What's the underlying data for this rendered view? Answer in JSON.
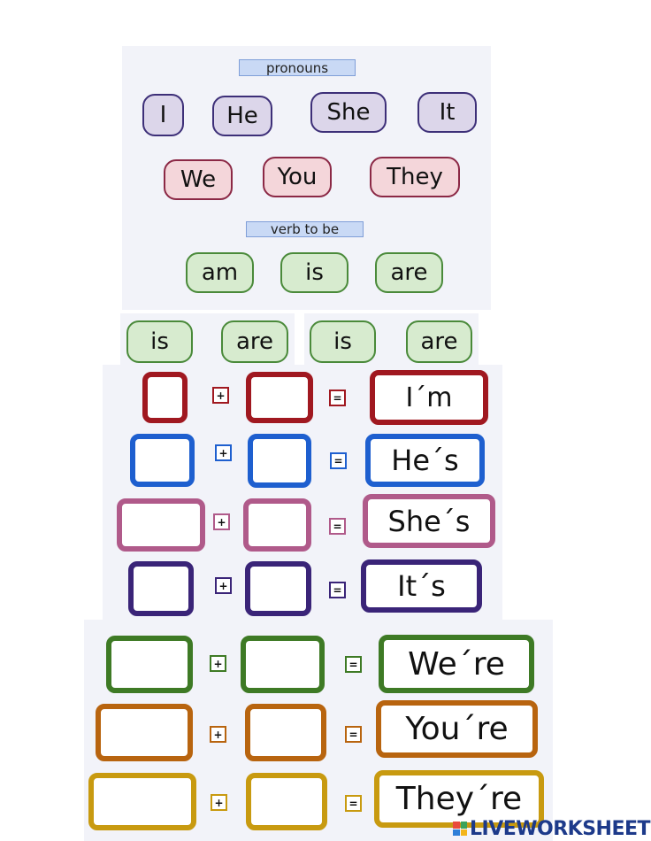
{
  "headings": {
    "pronouns": "pronouns",
    "verb_to_be": "verb to be"
  },
  "pronouns": [
    "I",
    "He",
    "She",
    "It",
    "We",
    "You",
    "They"
  ],
  "verbs": [
    "am",
    "is",
    "are"
  ],
  "verb_strip": [
    "is",
    "are",
    "is",
    "are"
  ],
  "operators": {
    "plus": "+",
    "equals": "="
  },
  "contractions": [
    {
      "result": "I´m",
      "color": "#a01820"
    },
    {
      "result": "He´s",
      "color": "#1e5fcf"
    },
    {
      "result": "She´s",
      "color": "#b05a8a"
    },
    {
      "result": "It´s",
      "color": "#3a2478"
    },
    {
      "result": "We´re",
      "color": "#3e7a25"
    },
    {
      "result": "You´re",
      "color": "#b8640f"
    },
    {
      "result": "They´re",
      "color": "#c89a10"
    }
  ],
  "watermark": "LIVEWORKSHEETS"
}
